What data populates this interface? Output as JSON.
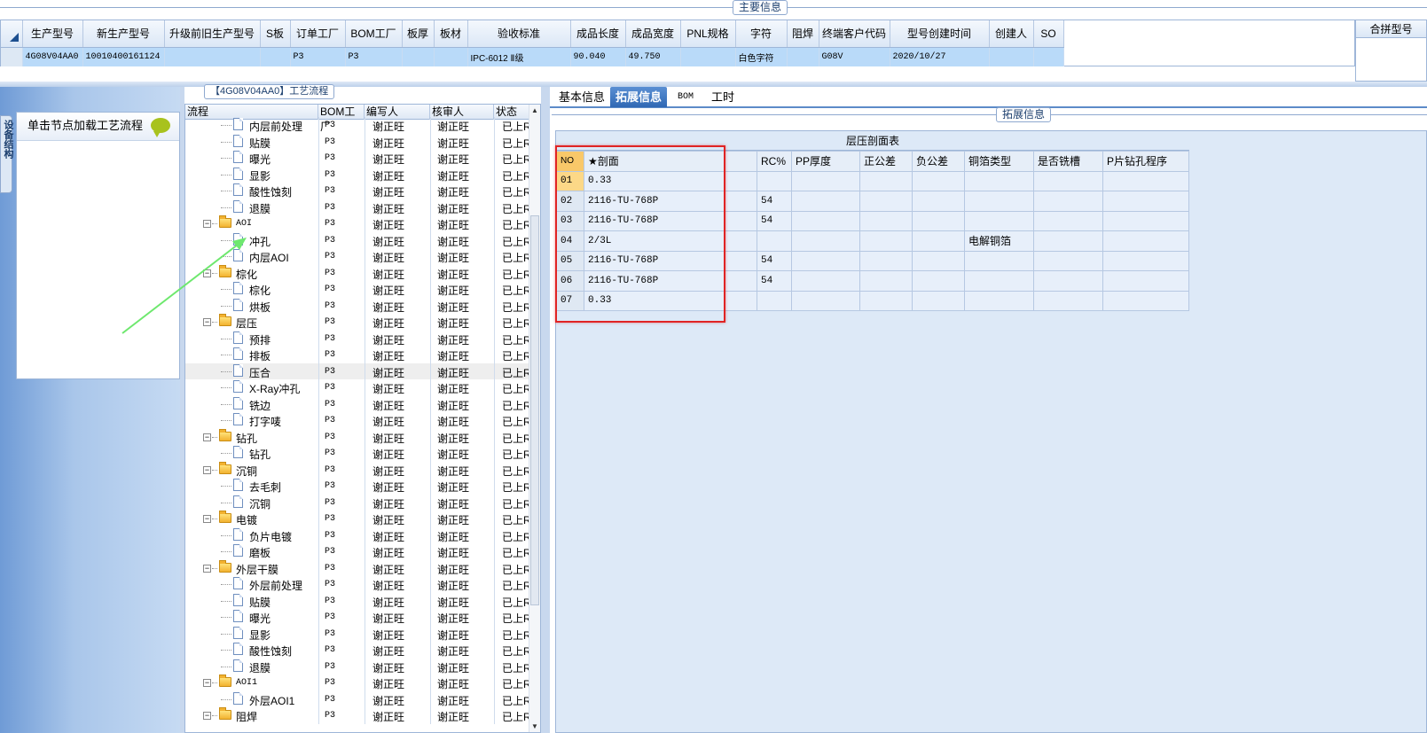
{
  "main_info_caption": "主要信息",
  "merge_label": "合拼型号",
  "product_grid": {
    "columns": [
      "生产型号",
      "新生产型号",
      "升级前旧生产型号",
      "S板",
      "订单工厂",
      "BOM工厂",
      "板厚",
      "板材",
      "验收标准",
      "成品长度",
      "成品宽度",
      "PNL规格",
      "字符",
      "阻焊",
      "终端客户代码",
      "型号创建时间",
      "创建人",
      "SO"
    ],
    "row": [
      "4G08V04AA0",
      "10010400161124",
      "",
      "",
      "P3",
      "P3",
      "",
      "",
      "IPC-6012 Ⅱ级",
      "90.040",
      "49.750",
      "",
      "白色字符",
      "",
      "G08V",
      "2020/10/27",
      "",
      ""
    ]
  },
  "left_panel": {
    "side_tab": "设备结构",
    "hint": "单击节点加载工艺流程"
  },
  "flow_caption": "【4G08V04AA0】工艺流程",
  "tree_headers": [
    "流程",
    "BOM工厂",
    "编写人",
    "核审人",
    "状态"
  ],
  "tree_rows": [
    {
      "type": "doc",
      "depth": 2,
      "label": "内层前处理",
      "bom": "P3",
      "writer": "谢正旺",
      "reviewer": "谢正旺",
      "status": "已上R"
    },
    {
      "type": "doc",
      "depth": 2,
      "label": "贴膜",
      "bom": "P3",
      "writer": "谢正旺",
      "reviewer": "谢正旺",
      "status": "已上R"
    },
    {
      "type": "doc",
      "depth": 2,
      "label": "曝光",
      "bom": "P3",
      "writer": "谢正旺",
      "reviewer": "谢正旺",
      "status": "已上R"
    },
    {
      "type": "doc",
      "depth": 2,
      "label": "显影",
      "bom": "P3",
      "writer": "谢正旺",
      "reviewer": "谢正旺",
      "status": "已上R"
    },
    {
      "type": "doc",
      "depth": 2,
      "label": "酸性蚀刻",
      "bom": "P3",
      "writer": "谢正旺",
      "reviewer": "谢正旺",
      "status": "已上R"
    },
    {
      "type": "doc",
      "depth": 2,
      "label": "退膜",
      "bom": "P3",
      "writer": "谢正旺",
      "reviewer": "谢正旺",
      "status": "已上R"
    },
    {
      "type": "folder",
      "depth": 1,
      "label": "AOI",
      "bom": "P3",
      "writer": "谢正旺",
      "reviewer": "谢正旺",
      "status": "已上R"
    },
    {
      "type": "doc",
      "depth": 2,
      "label": "冲孔",
      "bom": "P3",
      "writer": "谢正旺",
      "reviewer": "谢正旺",
      "status": "已上R"
    },
    {
      "type": "doc",
      "depth": 2,
      "label": "内层AOI",
      "bom": "P3",
      "writer": "谢正旺",
      "reviewer": "谢正旺",
      "status": "已上R"
    },
    {
      "type": "folder",
      "depth": 1,
      "label": "棕化",
      "bom": "P3",
      "writer": "谢正旺",
      "reviewer": "谢正旺",
      "status": "已上R"
    },
    {
      "type": "doc",
      "depth": 2,
      "label": "棕化",
      "bom": "P3",
      "writer": "谢正旺",
      "reviewer": "谢正旺",
      "status": "已上R"
    },
    {
      "type": "doc",
      "depth": 2,
      "label": "烘板",
      "bom": "P3",
      "writer": "谢正旺",
      "reviewer": "谢正旺",
      "status": "已上R"
    },
    {
      "type": "folder",
      "depth": 1,
      "label": "层压",
      "bom": "P3",
      "writer": "谢正旺",
      "reviewer": "谢正旺",
      "status": "已上R"
    },
    {
      "type": "doc",
      "depth": 2,
      "label": "预排",
      "bom": "P3",
      "writer": "谢正旺",
      "reviewer": "谢正旺",
      "status": "已上R"
    },
    {
      "type": "doc",
      "depth": 2,
      "label": "排板",
      "bom": "P3",
      "writer": "谢正旺",
      "reviewer": "谢正旺",
      "status": "已上R"
    },
    {
      "type": "doc",
      "depth": 2,
      "label": "压合",
      "bom": "P3",
      "writer": "谢正旺",
      "reviewer": "谢正旺",
      "status": "已上R",
      "selected": true
    },
    {
      "type": "doc",
      "depth": 2,
      "label": "X-Ray冲孔",
      "bom": "P3",
      "writer": "谢正旺",
      "reviewer": "谢正旺",
      "status": "已上R"
    },
    {
      "type": "doc",
      "depth": 2,
      "label": "铣边",
      "bom": "P3",
      "writer": "谢正旺",
      "reviewer": "谢正旺",
      "status": "已上R"
    },
    {
      "type": "doc",
      "depth": 2,
      "label": "打字唛",
      "bom": "P3",
      "writer": "谢正旺",
      "reviewer": "谢正旺",
      "status": "已上R"
    },
    {
      "type": "folder",
      "depth": 1,
      "label": "钻孔",
      "bom": "P3",
      "writer": "谢正旺",
      "reviewer": "谢正旺",
      "status": "已上R"
    },
    {
      "type": "doc",
      "depth": 2,
      "label": "钻孔",
      "bom": "P3",
      "writer": "谢正旺",
      "reviewer": "谢正旺",
      "status": "已上R"
    },
    {
      "type": "folder",
      "depth": 1,
      "label": "沉铜",
      "bom": "P3",
      "writer": "谢正旺",
      "reviewer": "谢正旺",
      "status": "已上R"
    },
    {
      "type": "doc",
      "depth": 2,
      "label": "去毛刺",
      "bom": "P3",
      "writer": "谢正旺",
      "reviewer": "谢正旺",
      "status": "已上R"
    },
    {
      "type": "doc",
      "depth": 2,
      "label": "沉铜",
      "bom": "P3",
      "writer": "谢正旺",
      "reviewer": "谢正旺",
      "status": "已上R"
    },
    {
      "type": "folder",
      "depth": 1,
      "label": "电镀",
      "bom": "P3",
      "writer": "谢正旺",
      "reviewer": "谢正旺",
      "status": "已上R"
    },
    {
      "type": "doc",
      "depth": 2,
      "label": "负片电镀",
      "bom": "P3",
      "writer": "谢正旺",
      "reviewer": "谢正旺",
      "status": "已上R"
    },
    {
      "type": "doc",
      "depth": 2,
      "label": "磨板",
      "bom": "P3",
      "writer": "谢正旺",
      "reviewer": "谢正旺",
      "status": "已上R"
    },
    {
      "type": "folder",
      "depth": 1,
      "label": "外层干膜",
      "bom": "P3",
      "writer": "谢正旺",
      "reviewer": "谢正旺",
      "status": "已上R"
    },
    {
      "type": "doc",
      "depth": 2,
      "label": "外层前处理",
      "bom": "P3",
      "writer": "谢正旺",
      "reviewer": "谢正旺",
      "status": "已上R"
    },
    {
      "type": "doc",
      "depth": 2,
      "label": "贴膜",
      "bom": "P3",
      "writer": "谢正旺",
      "reviewer": "谢正旺",
      "status": "已上R"
    },
    {
      "type": "doc",
      "depth": 2,
      "label": "曝光",
      "bom": "P3",
      "writer": "谢正旺",
      "reviewer": "谢正旺",
      "status": "已上R"
    },
    {
      "type": "doc",
      "depth": 2,
      "label": "显影",
      "bom": "P3",
      "writer": "谢正旺",
      "reviewer": "谢正旺",
      "status": "已上R"
    },
    {
      "type": "doc",
      "depth": 2,
      "label": "酸性蚀刻",
      "bom": "P3",
      "writer": "谢正旺",
      "reviewer": "谢正旺",
      "status": "已上R"
    },
    {
      "type": "doc",
      "depth": 2,
      "label": "退膜",
      "bom": "P3",
      "writer": "谢正旺",
      "reviewer": "谢正旺",
      "status": "已上R"
    },
    {
      "type": "folder",
      "depth": 1,
      "label": "AOI1",
      "bom": "P3",
      "writer": "谢正旺",
      "reviewer": "谢正旺",
      "status": "已上R"
    },
    {
      "type": "doc",
      "depth": 2,
      "label": "外层AOI1",
      "bom": "P3",
      "writer": "谢正旺",
      "reviewer": "谢正旺",
      "status": "已上R"
    },
    {
      "type": "folder",
      "depth": 1,
      "label": "阻焊",
      "bom": "P3",
      "writer": "谢正旺",
      "reviewer": "谢正旺",
      "status": "已上R"
    }
  ],
  "tabs": [
    "基本信息",
    "拓展信息",
    "BOM",
    "工时"
  ],
  "active_tab": "拓展信息",
  "ext_caption": "拓展信息",
  "stack_table": {
    "title": "层压剖面表",
    "headers": [
      "NO",
      "★剖面",
      "RC%",
      "PP厚度",
      "正公差",
      "负公差",
      "铜箔类型",
      "是否铣槽",
      "P片钻孔程序"
    ],
    "rows": [
      [
        "01",
        "0.33",
        "",
        "",
        "",
        "",
        "",
        "",
        ""
      ],
      [
        "02",
        "2116-TU-768P",
        "54",
        "",
        "",
        "",
        "",
        "",
        ""
      ],
      [
        "03",
        "2116-TU-768P",
        "54",
        "",
        "",
        "",
        "",
        "",
        ""
      ],
      [
        "04",
        "2/3L",
        "",
        "",
        "",
        "",
        "电解铜箔",
        "",
        ""
      ],
      [
        "05",
        "2116-TU-768P",
        "54",
        "",
        "",
        "",
        "",
        "",
        ""
      ],
      [
        "06",
        "2116-TU-768P",
        "54",
        "",
        "",
        "",
        "",
        "",
        ""
      ],
      [
        "07",
        "0.33",
        "",
        "",
        "",
        "",
        "",
        "",
        ""
      ]
    ]
  },
  "colors": {
    "accent": "#2f68b4",
    "highlight": "#e02424",
    "arrow": "#6ee86e",
    "row_selected": "#b9daf9"
  }
}
